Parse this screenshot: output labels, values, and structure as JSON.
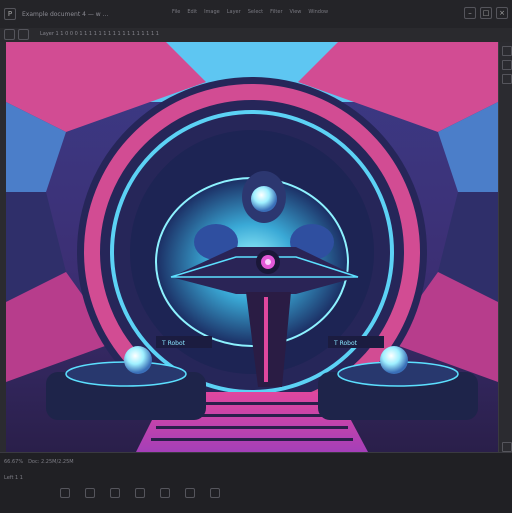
{
  "app": {
    "logo_letter": "P",
    "document_title": "Example document 4 — w ...",
    "menu": [
      "File",
      "Edit",
      "Image",
      "Layer",
      "Select",
      "Filter",
      "View",
      "Window"
    ]
  },
  "toolbar": {
    "path_text": "Layer 1 1 0 0 0 1 1 1 1 1 1 1 1 1 1 1 1 1 1 1 1 1"
  },
  "artwork": {
    "left_sign": "T Robot",
    "right_sign": "T Robot"
  },
  "status": {
    "zoom": "66.67%",
    "doc_info": "Doc: 2.25M/2.25M",
    "row3": "Left 1 1"
  },
  "colors": {
    "accent_pink": "#e0479e",
    "accent_cyan": "#5ce0ff",
    "deep_purple": "#2a1f4a"
  }
}
